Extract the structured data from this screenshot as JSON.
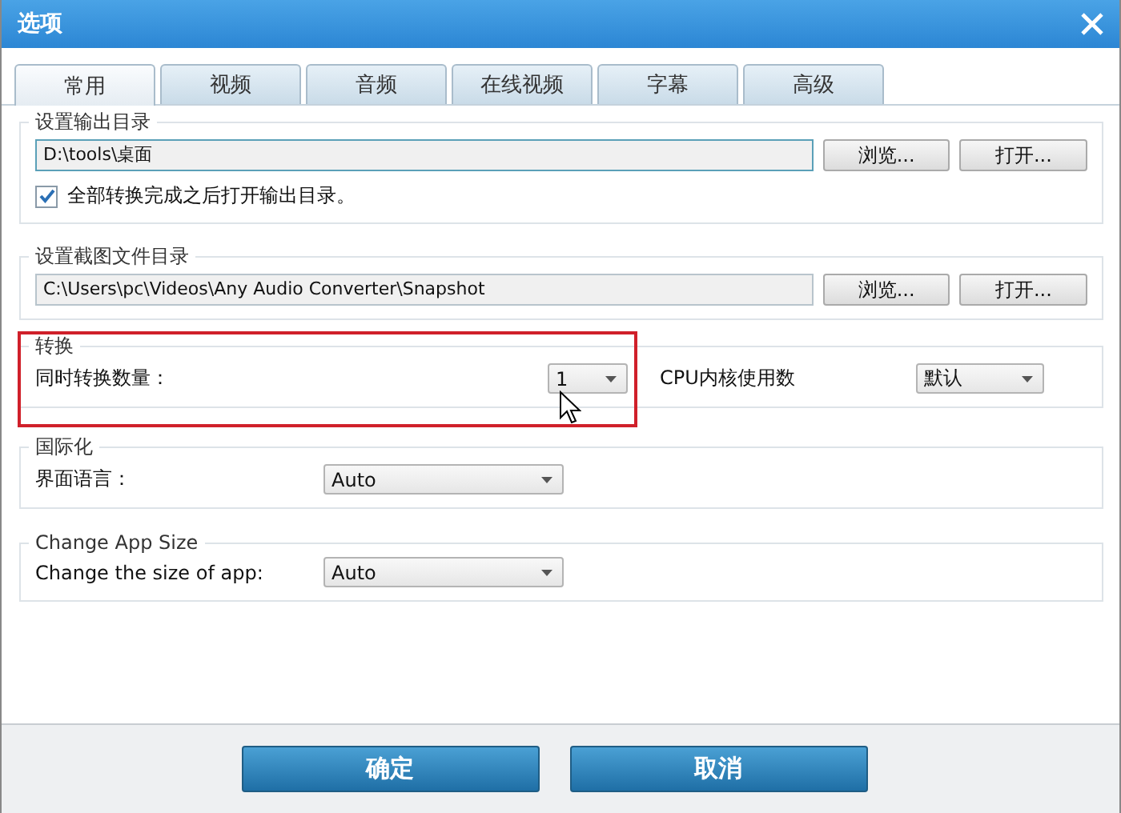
{
  "window": {
    "title": "选项"
  },
  "tabs": [
    {
      "label": "常用",
      "selected": true
    },
    {
      "label": "视频",
      "selected": false
    },
    {
      "label": "音频",
      "selected": false
    },
    {
      "label": "在线视频",
      "selected": false
    },
    {
      "label": "字幕",
      "selected": false
    },
    {
      "label": "高级",
      "selected": false
    }
  ],
  "sections": [
    {
      "kind": "folder",
      "title": "设置输出目录",
      "path": "D:\\tools\\桌面",
      "focused": true,
      "buttons": [
        "浏览...",
        "打开..."
      ],
      "checkbox": {
        "label": "全部转换完成之后打开输出目录。",
        "checked": true
      }
    },
    {
      "kind": "folder",
      "title": "设置截图文件目录",
      "path": "C:\\Users\\pc\\Videos\\Any Audio Converter\\Snapshot",
      "focused": false,
      "buttons": [
        "浏览...",
        "打开..."
      ]
    },
    {
      "kind": "dual",
      "title": "转换",
      "highlighted": true,
      "label": "同时转换数量：",
      "value": "1",
      "label2": "CPU内核使用数",
      "value2": "默认"
    },
    {
      "kind": "select",
      "title": "国际化",
      "label": "界面语言：",
      "value": "Auto"
    },
    {
      "kind": "select",
      "title": "Change App Size",
      "label": "Change the size of app:",
      "value": "Auto"
    }
  ],
  "buttons": [
    "确定",
    "取消"
  ]
}
